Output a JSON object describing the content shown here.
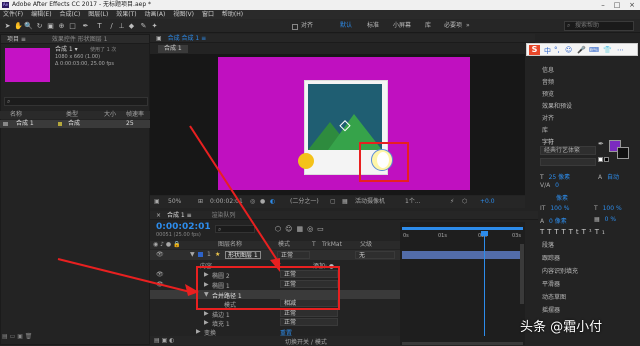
{
  "window": {
    "title": "Adobe After Effects CC 2017 - 无标题项目.aep *",
    "app_icon": "Ae"
  },
  "menu": [
    "文件(F)",
    "编辑(E)",
    "合成(C)",
    "图层(L)",
    "效果(T)",
    "动画(A)",
    "视图(V)",
    "窗口",
    "帮助(H)"
  ],
  "toolbar": {
    "align_label": "对齐",
    "workspaces": [
      "默认",
      "标准",
      "小屏幕",
      "库",
      "必要项",
      "»"
    ],
    "search_placeholder": "搜索帮助"
  },
  "project": {
    "tabs": [
      "项目 ≡",
      "效果控件 形状图层 1"
    ],
    "item_name": "合成 1 ▾",
    "item_info1": "使用了 1 次",
    "item_info2": "1080 x 660 (1.00)",
    "item_info3": "Δ 0:00:03:00, 25.00 fps",
    "search_icon": "search-icon",
    "columns": [
      "名称",
      "类型",
      "大小",
      "帧速率"
    ],
    "row": {
      "name": "合成 1",
      "type": "合成",
      "fps": "25"
    }
  },
  "composition": {
    "tab": "合成 合成 1 ≡",
    "sub_tab": "合成 1",
    "bg_color": "#c010c0"
  },
  "viewer_bar": {
    "zoom": "50%",
    "time": "0:00:02:01",
    "resolution": "(二分之一)",
    "camera": "活动摄像机",
    "views": "1个...",
    "exposure": "+0.0"
  },
  "timeline": {
    "tabs": [
      "合成 1 ≡",
      "渲染队列"
    ],
    "current_time": "0:00:02:01",
    "frame_info": "00051 (25.00 fps)",
    "columns": [
      "图层名称",
      "模式",
      "T",
      "TrkMat",
      "父级"
    ],
    "layer_name": "形状图层 1",
    "layer_num": "1",
    "mode": "正常",
    "parent": "无",
    "content_label": "内容",
    "add_label": "添加: ●",
    "groups": [
      {
        "name": "椭圆 2",
        "mode": "正常"
      },
      {
        "name": "椭圆 1",
        "mode": "正常"
      },
      {
        "name": "合并路径 1",
        "mode": ""
      },
      {
        "name": "模式",
        "mode": "相减"
      },
      {
        "name": "描边 1",
        "mode": "正常"
      },
      {
        "name": "填充 1",
        "mode": "正常"
      }
    ],
    "transform_label": "变换",
    "reset_label": "重置",
    "toggle_label": "切换开关 / 模式",
    "ruler": [
      "0s",
      "01s",
      "02s",
      "03s"
    ]
  },
  "right_panel": {
    "items": [
      "信息",
      "音频",
      "预览",
      "效果和预设",
      "对齐",
      "库",
      "字符"
    ],
    "font_name": "经典行艺体繁",
    "font_size": "25 像素",
    "leading": "自动",
    "tracking": "像素",
    "kerning": "0",
    "size_pct1": "100 %",
    "size_pct2": "100 %",
    "baseline": "0 像素",
    "tsume": "0 %",
    "bottom_items": [
      "段落",
      "跟踪器",
      "内容识别填充",
      "平滑器",
      "动态草图",
      "摇摆器"
    ]
  },
  "ime_bar": {
    "logo": "S",
    "items": [
      "中",
      "°,",
      "☺",
      "🎤",
      "⌨",
      "👕",
      "⋯"
    ]
  },
  "watermark": "头条 @霜小付",
  "colors": {
    "accent": "#e82020",
    "magenta": "#c010c0",
    "blue": "#2d8ceb"
  }
}
